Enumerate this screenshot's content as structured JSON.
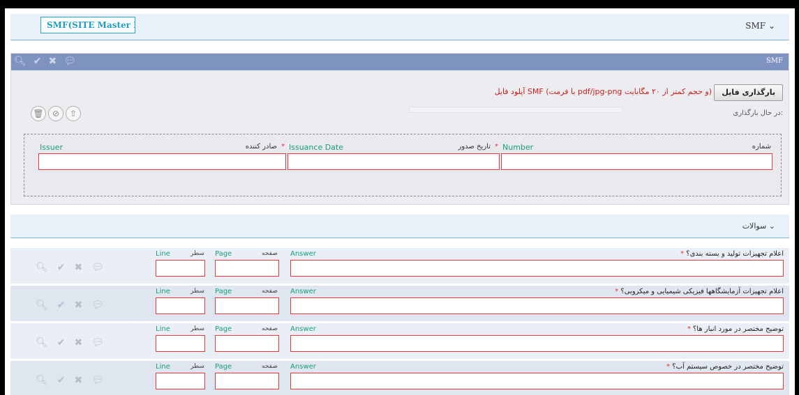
{
  "header": {
    "tab_label": "SMF(SITE Master File",
    "dropdown_label": "SMF ⌄"
  },
  "panel": {
    "title": "SMF",
    "toolbar_icons": [
      "search-icon",
      "check-icon",
      "close-icon",
      "comment-icon"
    ],
    "upload_button": "بارگذاری فایل",
    "upload_note": "آپلود فایل SMF (با فرمت pdf/jpg-png و حجم کمتر از ۲۰ مگابایت)",
    "upload_state": "در حال بارگذاری:",
    "file_icons": [
      "trash-icon",
      "cancel-icon",
      "upload-icon"
    ]
  },
  "form": {
    "issuer": {
      "en": "Issuer",
      "fa": "صادر کننده"
    },
    "issuance_date": {
      "en": "Issuance Date",
      "fa": "تاریخ صدور"
    },
    "number": {
      "en": "Number",
      "fa": "شماره"
    },
    "required_mark": "*"
  },
  "questions": {
    "section_title": "سوالات ⌄",
    "col_line": "Line",
    "col_line_fa": "سطر",
    "col_page": "Page",
    "col_page_fa": "صفحه",
    "col_answer": "Answer",
    "required_mark": "*",
    "rows": [
      {
        "text": "اعلام تجهیزات تولید و بسته بندی؟"
      },
      {
        "text": "اعلام تجهیزات آزمایشگاهها فیزیکی شیمیایی و میکروبی؟"
      },
      {
        "text": "توضیح مختصر در مورد انبار ها؟"
      },
      {
        "text": "توضیح مختصر در خصوص سیستم آب؟"
      }
    ],
    "row_icons": [
      "search-icon",
      "check-icon",
      "close-icon",
      "comment-icon"
    ]
  }
}
